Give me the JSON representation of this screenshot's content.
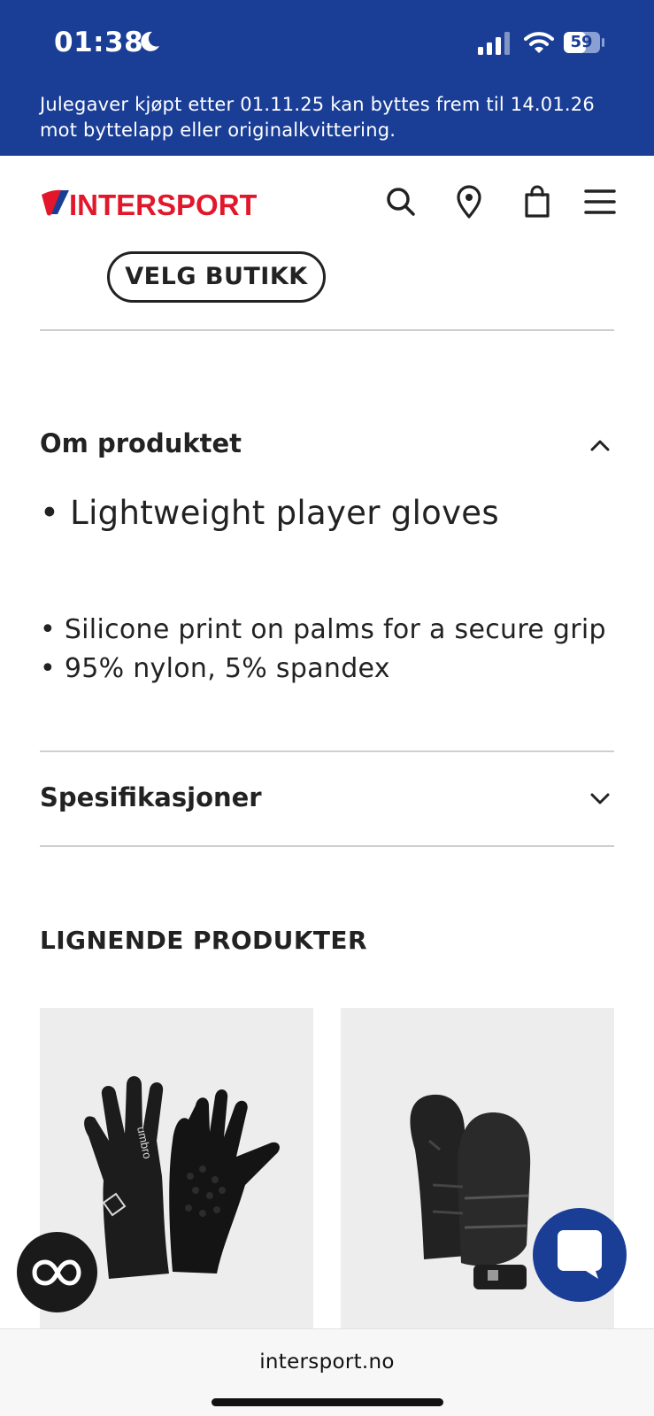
{
  "status_bar": {
    "time": "01:38",
    "battery_level": "59"
  },
  "promo_banner": {
    "line1": "Julegaver kjøpt etter 01.11.25 kan byttes frem til 14.01.26",
    "line2": "mot byttelapp eller originalkvittering."
  },
  "header": {
    "logo_text": "INTERSPORT",
    "icons": [
      "search-icon",
      "location-pin-icon",
      "shopping-bag-icon",
      "hamburger-menu-icon"
    ]
  },
  "store": {
    "button_label": "VELG BUTIKK"
  },
  "about": {
    "title": "Om produktet",
    "bullets_primary": [
      "• Lightweight player gloves"
    ],
    "bullets_secondary": [
      "• Silicone print on palms for a secure grip",
      "• 95% nylon, 5% spandex"
    ]
  },
  "specs": {
    "title": "Spesifikasjoner"
  },
  "similar": {
    "title": "LIGNENDE PRODUKTER"
  },
  "browser": {
    "domain": "intersport.no"
  },
  "colors": {
    "brand_blue": "#1a3e96",
    "brand_red": "#e2172b",
    "text_dark": "#222222"
  }
}
